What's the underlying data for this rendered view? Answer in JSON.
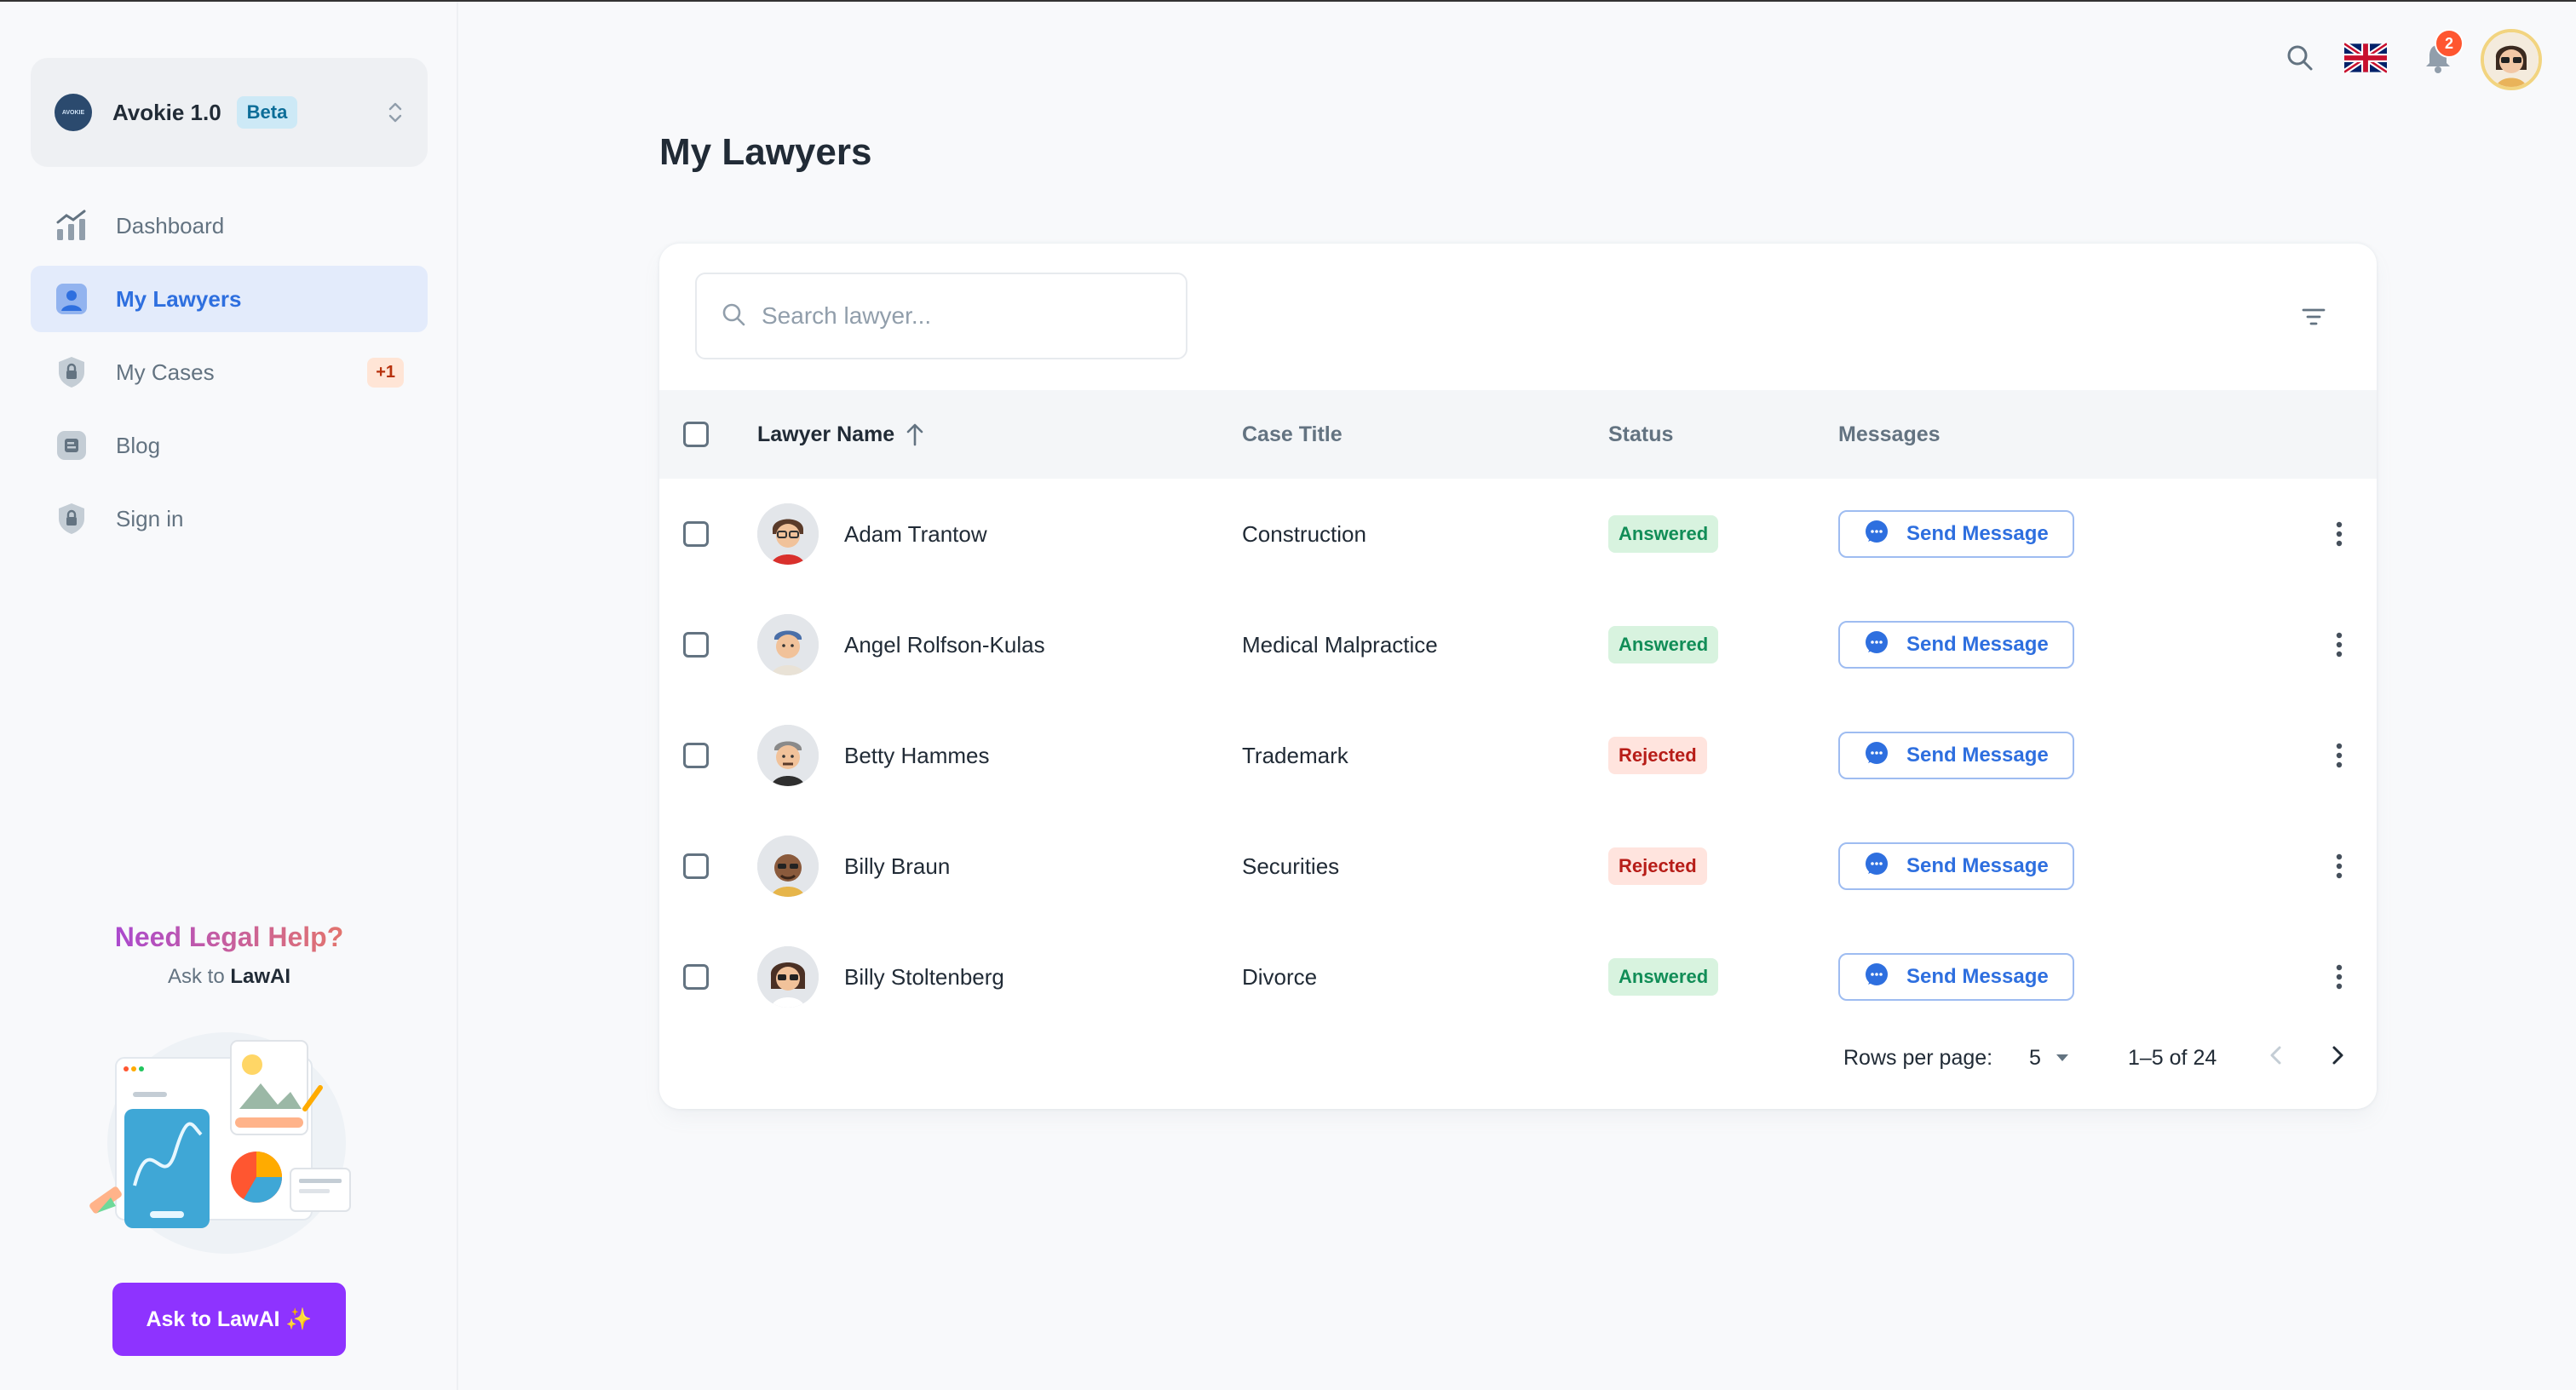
{
  "workspace": {
    "name": "Avokie 1.0",
    "badge": "Beta",
    "logo_text": "AVOKIE"
  },
  "nav": [
    {
      "label": "Dashboard",
      "icon": "chart-icon",
      "active": false
    },
    {
      "label": "My Lawyers",
      "icon": "user-icon",
      "active": true
    },
    {
      "label": "My Cases",
      "icon": "lock-icon",
      "active": false,
      "badge": "+1"
    },
    {
      "label": "Blog",
      "icon": "blog-icon",
      "active": false
    },
    {
      "label": "Sign in",
      "icon": "lock-icon",
      "active": false
    }
  ],
  "help": {
    "title": "Need Legal Help?",
    "sub_prefix": "Ask to",
    "sub_brand": "LawAI",
    "button": "Ask to LawAI ✨"
  },
  "topbar": {
    "notification_count": "2",
    "language": "English (UK)"
  },
  "page": {
    "title": "My Lawyers"
  },
  "search": {
    "placeholder": "Search lawyer..."
  },
  "table": {
    "headers": {
      "name": "Lawyer Name",
      "case": "Case Title",
      "status": "Status",
      "messages": "Messages"
    },
    "sort": "ascending",
    "rows": [
      {
        "name": "Adam Trantow",
        "case": "Construction",
        "status": "Answered",
        "action": "Send Message"
      },
      {
        "name": "Angel Rolfson-Kulas",
        "case": "Medical Malpractice",
        "status": "Answered",
        "action": "Send Message"
      },
      {
        "name": "Betty Hammes",
        "case": "Trademark",
        "status": "Rejected",
        "action": "Send Message"
      },
      {
        "name": "Billy Braun",
        "case": "Securities",
        "status": "Rejected",
        "action": "Send Message"
      },
      {
        "name": "Billy Stoltenberg",
        "case": "Divorce",
        "status": "Answered",
        "action": "Send Message"
      }
    ]
  },
  "pagination": {
    "rows_label": "Rows per page:",
    "rows_value": "5",
    "range": "1–5 of 24"
  },
  "colors": {
    "primary": "#2e6fdf",
    "accent_purple": "#8e33ff",
    "answered": "#118d57",
    "rejected": "#b71d18"
  }
}
